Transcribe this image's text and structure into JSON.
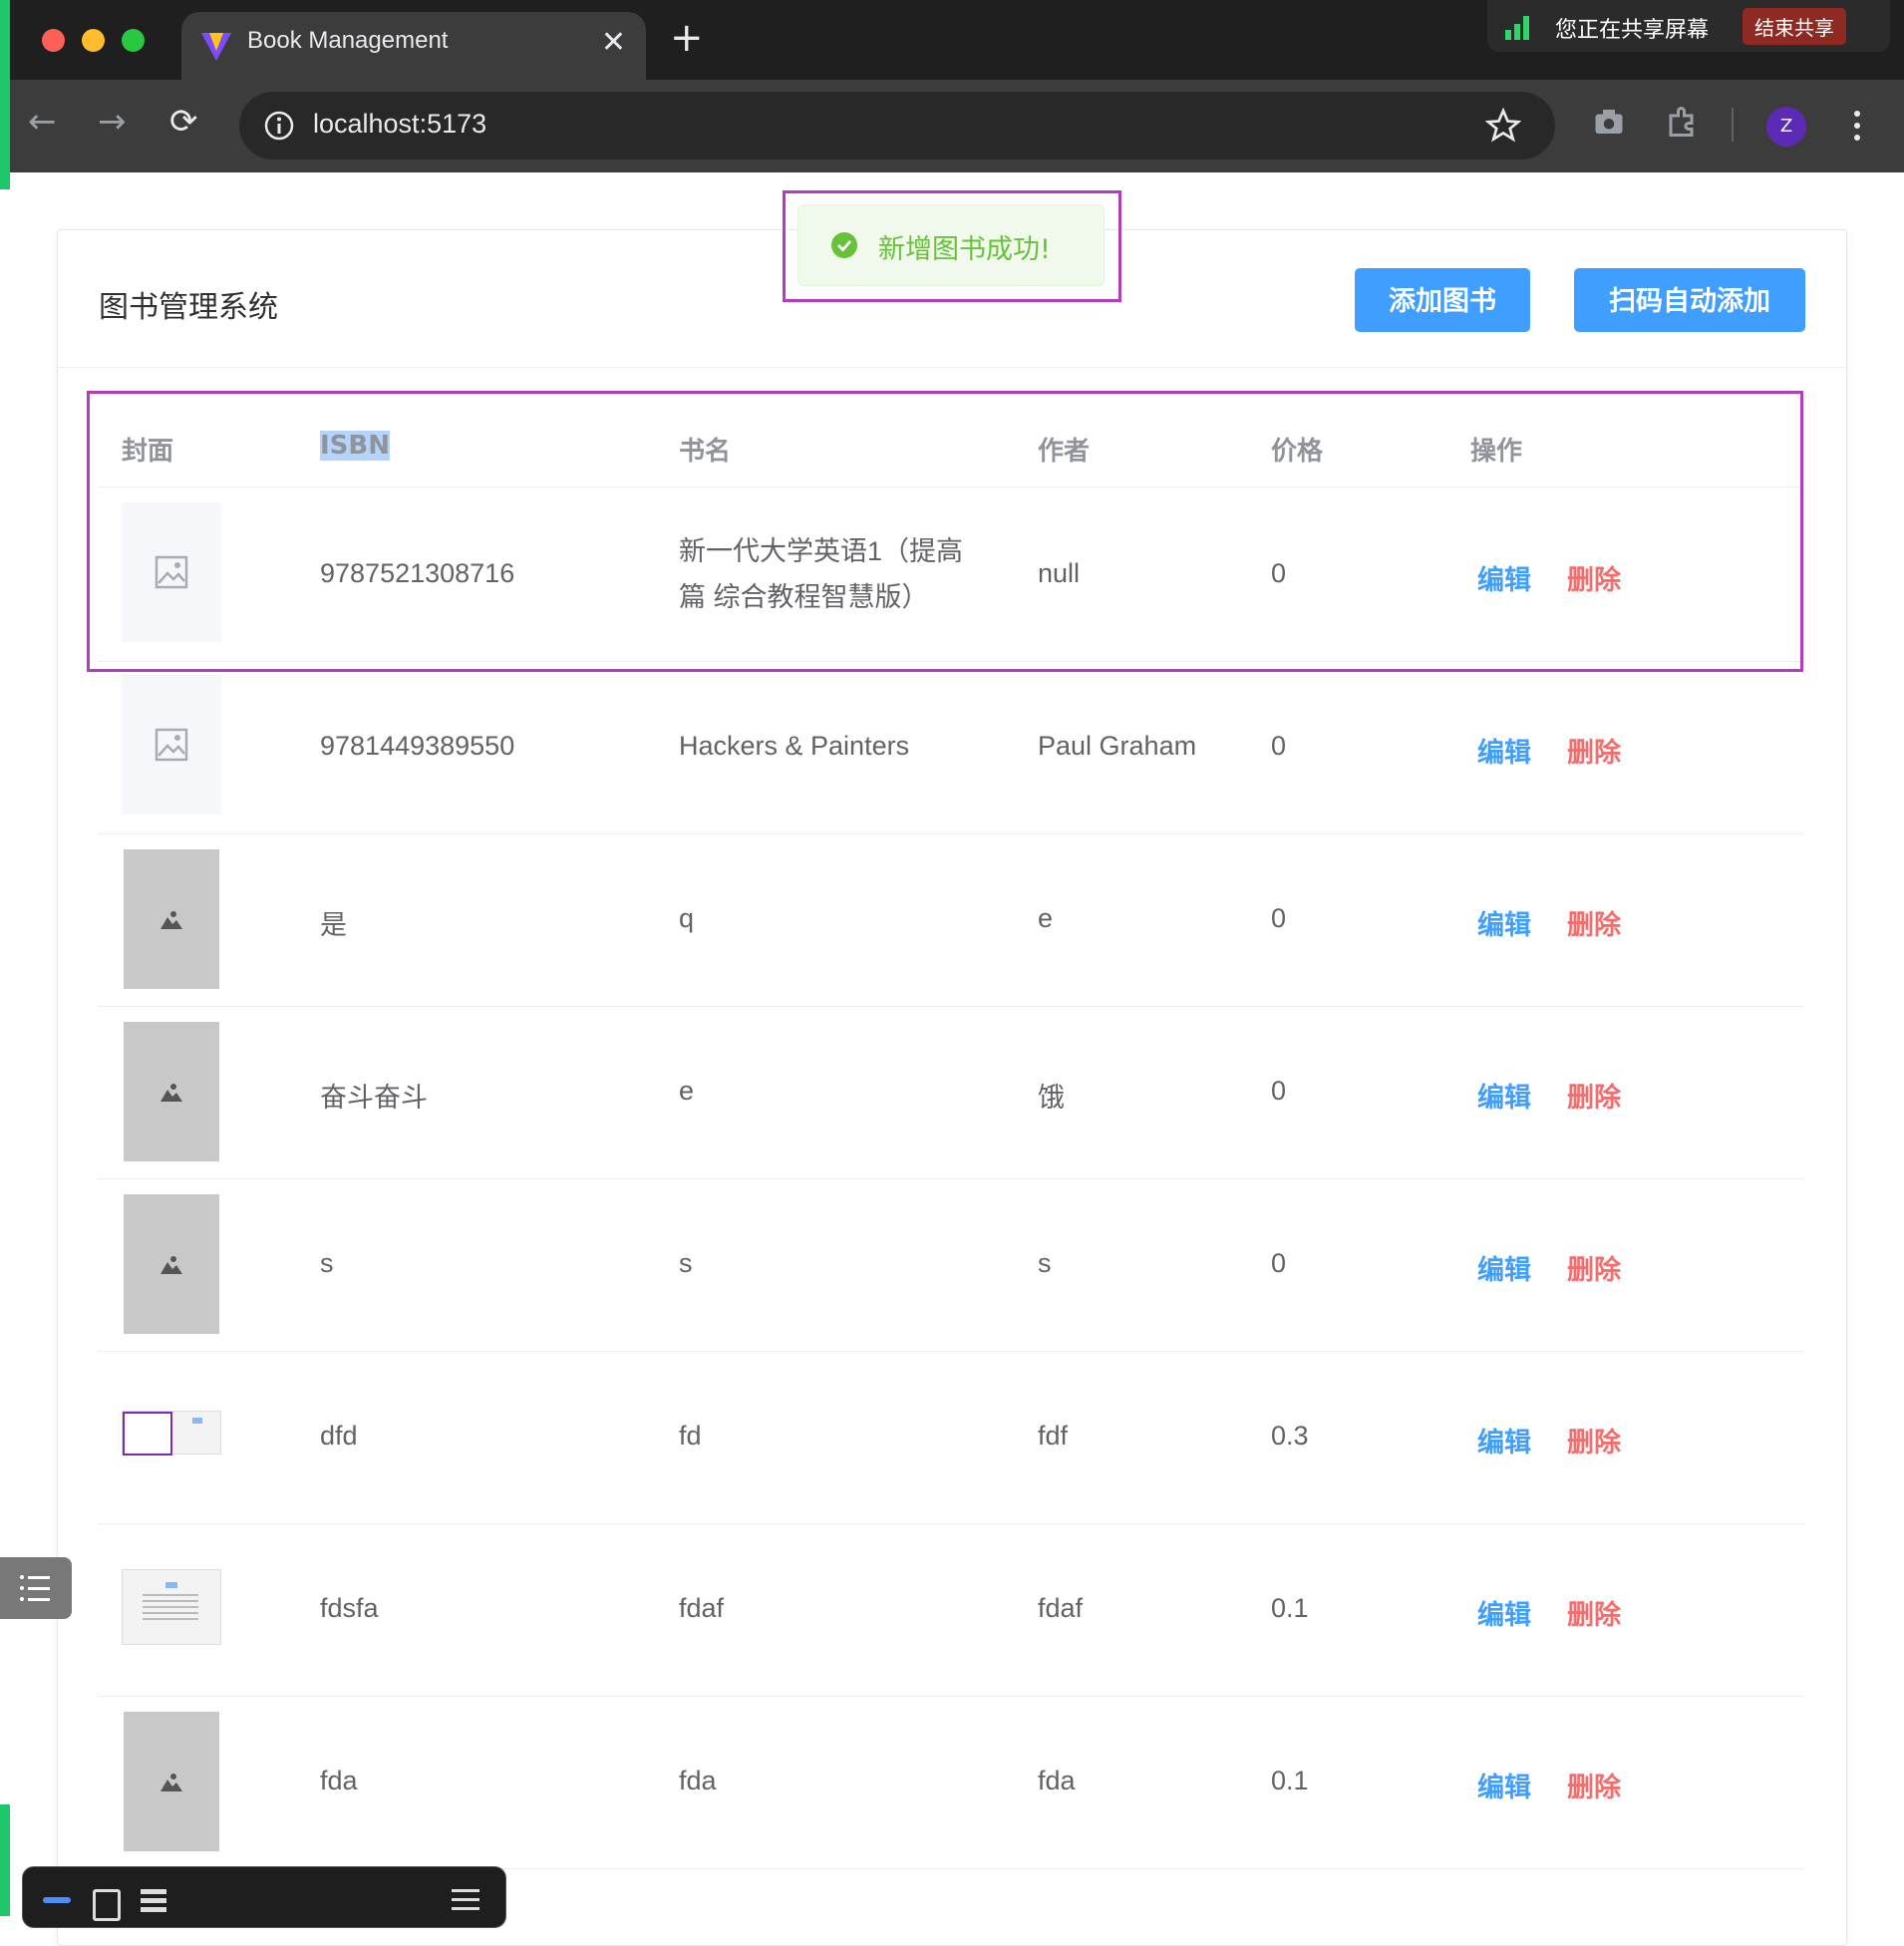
{
  "browser": {
    "tab_title": "Book Management",
    "tab_close": "✕",
    "new_tab": "+",
    "url": "localhost:5173",
    "profile_initial": "Z",
    "back": "←",
    "forward": "→",
    "reload": "⟳"
  },
  "share_bar": {
    "text": "您正在共享屏幕",
    "stop_label": "结束共享"
  },
  "page": {
    "title": "图书管理系统",
    "add_button": "添加图书",
    "scan_button": "扫码自动添加"
  },
  "toast": {
    "message": "新增图书成功!"
  },
  "table": {
    "headers": [
      "封面",
      "ISBN",
      "书名",
      "作者",
      "价格",
      "操作"
    ],
    "edit_label": "编辑",
    "delete_label": "删除",
    "rows": [
      {
        "cover": "placeholder",
        "isbn": "9787521308716",
        "title": "新一代大学英语1（提高篇 综合教程智慧版）",
        "author": "null",
        "price": "0"
      },
      {
        "cover": "placeholder",
        "isbn": "9781449389550",
        "title": "Hackers & Painters",
        "author": "Paul Graham",
        "price": "0"
      },
      {
        "cover": "grey",
        "isbn": "是",
        "title": "q",
        "author": "e",
        "price": "0"
      },
      {
        "cover": "grey",
        "isbn": "奋斗奋斗",
        "title": "e",
        "author": "饿",
        "price": "0"
      },
      {
        "cover": "grey",
        "isbn": "s",
        "title": "s",
        "author": "s",
        "price": "0"
      },
      {
        "cover": "screenshot",
        "isbn": "dfd",
        "title": "fd",
        "author": "fdf",
        "price": "0.3"
      },
      {
        "cover": "screenshot",
        "isbn": "fdsfa",
        "title": "fdaf",
        "author": "fdaf",
        "price": "0.1"
      },
      {
        "cover": "grey",
        "isbn": "fda",
        "title": "fda",
        "author": "fda",
        "price": "0.1"
      }
    ]
  },
  "colors": {
    "primary": "#409eff",
    "danger": "#f56c6c",
    "success": "#67c23a",
    "highlight": "#b43bbd"
  },
  "icons": [
    "vite-logo-icon",
    "info-icon",
    "star-icon",
    "camera-icon",
    "extension-icon",
    "more-vert-icon",
    "check-circle-icon",
    "image-placeholder-icon",
    "list-icon",
    "signal-bars-icon"
  ]
}
